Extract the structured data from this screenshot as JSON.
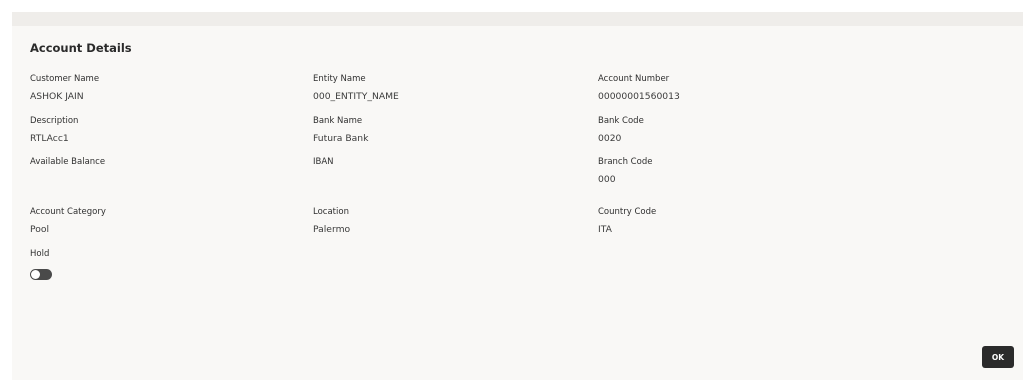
{
  "panel": {
    "title": "Account Details",
    "fields": [
      {
        "label": "Customer Name",
        "value": "ASHOK JAIN"
      },
      {
        "label": "Entity Name",
        "value": "000_ENTITY_NAME"
      },
      {
        "label": "Account Number",
        "value": "00000001560013"
      },
      {
        "label": "Description",
        "value": "RTLAcc1"
      },
      {
        "label": "Bank Name",
        "value": "Futura Bank"
      },
      {
        "label": "Bank Code",
        "value": "0020"
      },
      {
        "label": "Available Balance",
        "value": ""
      },
      {
        "label": "IBAN",
        "value": ""
      },
      {
        "label": "Branch Code",
        "value": "000"
      },
      {
        "label": "Account Category",
        "value": "Pool"
      },
      {
        "label": "Location",
        "value": "Palermo"
      },
      {
        "label": "Country Code",
        "value": "ITA"
      }
    ],
    "hold": {
      "label": "Hold",
      "on": false
    },
    "ok_label": "OK"
  }
}
